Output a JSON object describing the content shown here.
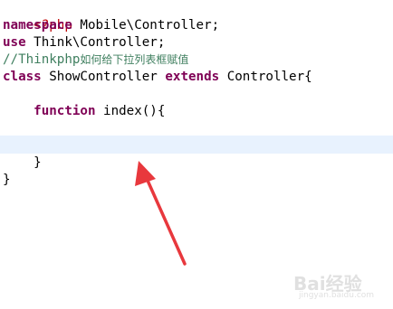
{
  "editor": {
    "line1": {
      "tag": "<?php"
    },
    "line2": {
      "keyword": "namespace",
      "rest": " Mobile\\Controller;"
    },
    "line3": {
      "keyword": "use",
      "rest": " Think\\Controller;"
    },
    "line4": {
      "comment_prefix": "//Thinkphp",
      "comment_text": "如何给下拉列表框赋值"
    },
    "line5": {
      "keyword1": "class",
      "name": " ShowController ",
      "keyword2": "extends",
      "rest": " Controller{"
    },
    "line7": {
      "indent": "    ",
      "keyword": "function",
      "rest": " index(){"
    },
    "line10": {
      "text": "    }"
    },
    "line11": {
      "text": "}"
    }
  },
  "watermark": {
    "brand": "Bai经验",
    "url": "jingyan.baidu.com"
  },
  "colors": {
    "keyword": "#7f0055",
    "php_tag": "#c00000",
    "comment": "#3f7f5f",
    "current_line": "#e8f2fe",
    "arrow": "#e8383d"
  }
}
